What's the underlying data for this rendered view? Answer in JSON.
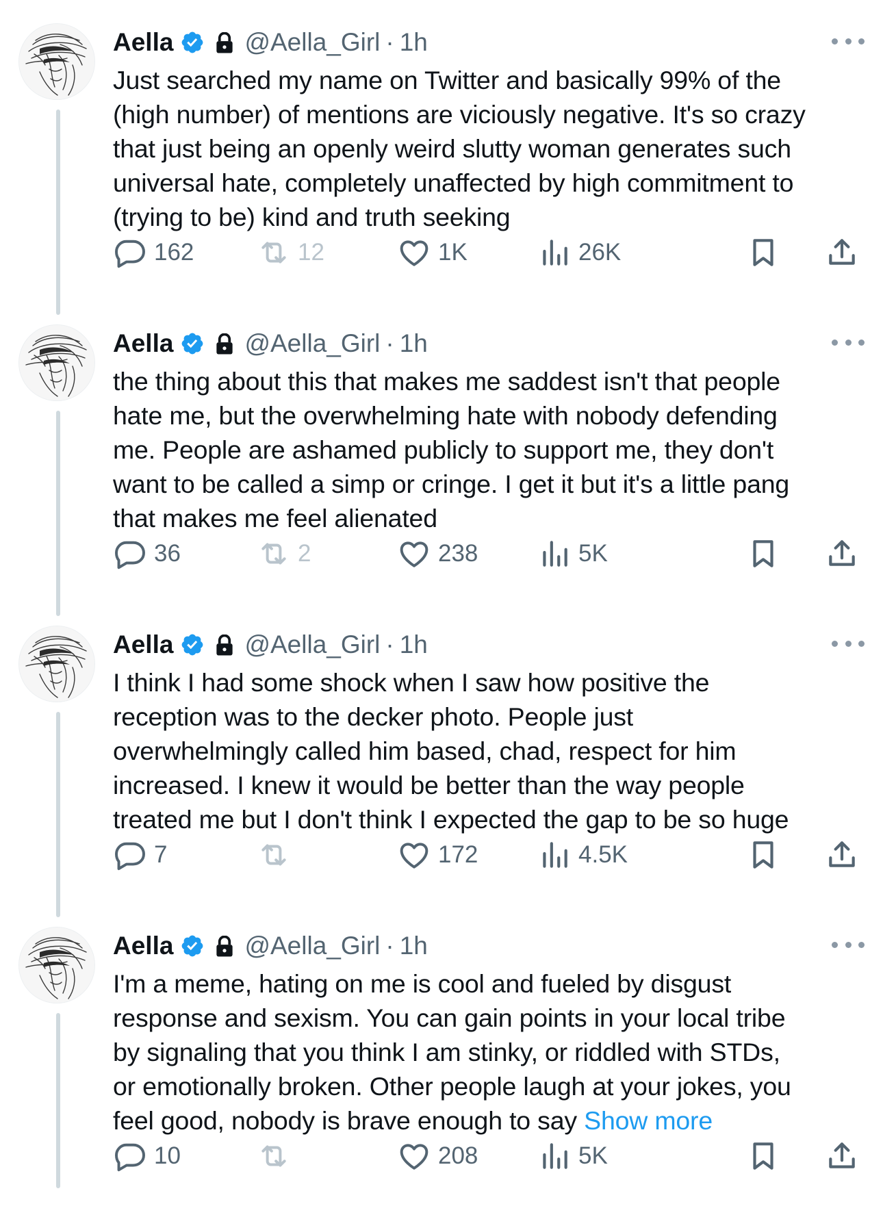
{
  "colors": {
    "text": "#0f1419",
    "muted": "#536471",
    "accent": "#1d9bf0",
    "thread_line": "#cfd9de"
  },
  "icons": {
    "reply": "speech-bubble-icon",
    "retweet": "retweet-arrows-icon",
    "like": "heart-icon",
    "views": "bar-chart-icon",
    "bookmark": "bookmark-icon",
    "share": "upload-arrow-icon",
    "more": "ellipsis-icon",
    "verified": "verified-badge-icon",
    "protected": "lock-icon"
  },
  "tweets": [
    {
      "name": "Aella",
      "handle": "@Aella_Girl",
      "sep": "·",
      "time": "1h",
      "lines": [
        "Just searched my name on Twitter and basically 99% of the",
        "(high number) of mentions are viciously negative. It's so crazy",
        "that just being an openly weird slutty woman generates such",
        "universal hate, completely unaffected by high commitment to",
        "(trying to be) kind and truth seeking"
      ],
      "show_more": "",
      "replies": "162",
      "retweets": "12",
      "likes": "1K",
      "views": "26K"
    },
    {
      "name": "Aella",
      "handle": "@Aella_Girl",
      "sep": "·",
      "time": "1h",
      "lines": [
        "the thing about this that makes me saddest isn't that people",
        "hate me, but the overwhelming hate with nobody defending",
        "me. People are ashamed publicly to support me, they don't",
        "want to be called a simp or cringe. I get it but it's a little pang",
        "that makes me feel alienated"
      ],
      "show_more": "",
      "replies": "36",
      "retweets": "2",
      "likes": "238",
      "views": "5K"
    },
    {
      "name": "Aella",
      "handle": "@Aella_Girl",
      "sep": "·",
      "time": "1h",
      "lines": [
        "I think I had some shock when I saw how positive the",
        "reception was to the decker photo. People just",
        "overwhelmingly called him based, chad, respect for him",
        "increased. I knew it would be better than the way people",
        "treated me but I don't think I expected the gap to be so huge"
      ],
      "show_more": "",
      "replies": "7",
      "retweets": "",
      "likes": "172",
      "views": "4.5K"
    },
    {
      "name": "Aella",
      "handle": "@Aella_Girl",
      "sep": "·",
      "time": "1h",
      "lines": [
        "I'm a meme, hating on me is cool and fueled by disgust",
        "response and sexism. You can gain points in your local tribe",
        "by signaling that you think I am stinky, or riddled with STDs,",
        "or emotionally broken. Other people laugh at your jokes, you",
        "feel good, nobody is brave enough to say "
      ],
      "show_more": "Show more",
      "replies": "10",
      "retweets": "",
      "likes": "208",
      "views": "5K"
    }
  ]
}
